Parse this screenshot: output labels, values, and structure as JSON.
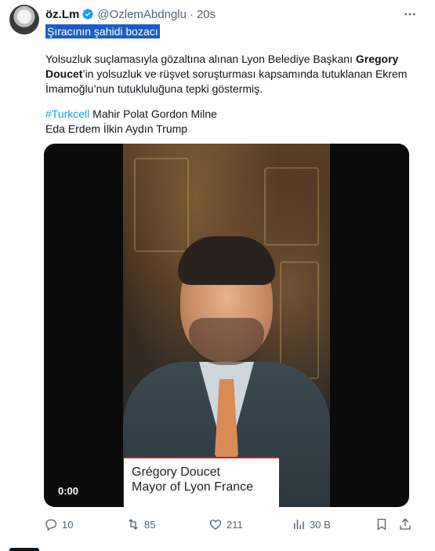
{
  "tweet": {
    "display_name": "öz.Lm",
    "handle": "@OzlemAbdnglu",
    "separator": "·",
    "timestamp": "20s",
    "selected_text": "Şıracının şahidi bozacı",
    "body": {
      "part1": "Yolsuzluk suçlamasıyla gözaltına alınan Lyon Belediye Başkanı ",
      "bold_name": "Gregory Doucet",
      "part2": "’in yolsuzluk ve rüşvet soruşturması kapsamında tutuklanan Ekrem İmamoğlu’nun tutukluluğuna tepki göstermiş."
    },
    "hashtag": "#Turkcell",
    "tags_line1_rest": " Mahir Polat Gordon Milne",
    "tags_line2": "Eda Erdem İlkin Aydın Trump"
  },
  "media": {
    "lower_third_name": "Grégory Doucet",
    "lower_third_title": "Mayor of Lyon France",
    "timecode": "0:00"
  },
  "actions": {
    "replies": "10",
    "retweets": "85",
    "likes": "211",
    "views": "30 B"
  },
  "icons": {
    "verified": "verified-badge-icon",
    "more": "more-icon",
    "reply": "reply-icon",
    "retweet": "retweet-icon",
    "like": "heart-icon",
    "views": "views-icon",
    "bookmark": "bookmark-icon",
    "share": "share-icon"
  },
  "colors": {
    "accent": "#1d9bf0",
    "selection": "#1a5dc8",
    "muted": "#536471",
    "text": "#0f1419"
  }
}
